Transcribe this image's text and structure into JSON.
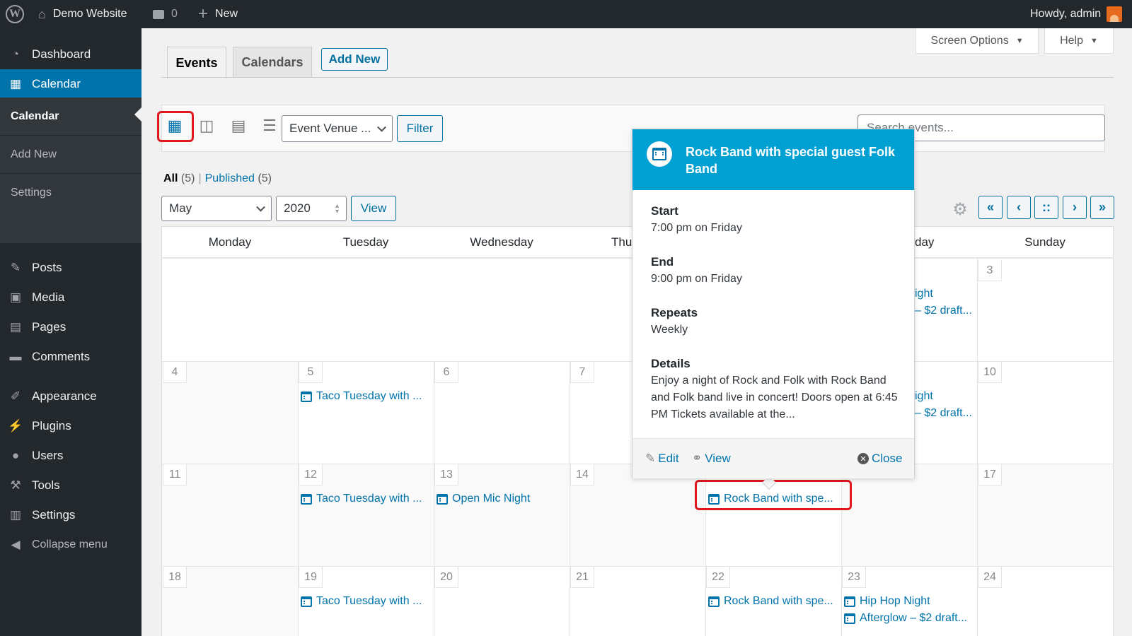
{
  "adminbar": {
    "site_name": "Demo Website",
    "comments_count": "0",
    "new_label": "New",
    "howdy": "Howdy, admin"
  },
  "sidebar": {
    "items": [
      {
        "label": "Dashboard",
        "icon": "dashboard-icon"
      },
      {
        "label": "Calendar",
        "icon": "calendar-icon"
      },
      {
        "label": "Posts",
        "icon": "pushpin-icon"
      },
      {
        "label": "Media",
        "icon": "media-icon"
      },
      {
        "label": "Pages",
        "icon": "pages-icon"
      },
      {
        "label": "Comments",
        "icon": "comment-icon"
      },
      {
        "label": "Appearance",
        "icon": "brush-icon"
      },
      {
        "label": "Plugins",
        "icon": "plug-icon"
      },
      {
        "label": "Users",
        "icon": "user-icon"
      },
      {
        "label": "Tools",
        "icon": "wrench-icon"
      },
      {
        "label": "Settings",
        "icon": "settings-icon"
      },
      {
        "label": "Collapse menu",
        "icon": "collapse-icon"
      }
    ],
    "submenu": [
      "Calendar",
      "Add New",
      "Settings"
    ]
  },
  "screen_options": "Screen Options",
  "help": "Help",
  "tabs": [
    "Events",
    "Calendars"
  ],
  "add_new": "Add New",
  "toolbar": {
    "venue_select": "Event Venue ...",
    "filter": "Filter",
    "search_placeholder": "Search events..."
  },
  "status": {
    "all": "All",
    "all_count": "(5)",
    "sep": "|",
    "published": "Published",
    "published_count": "(5)"
  },
  "date_controls": {
    "month": "May",
    "year": "2020",
    "view": "View"
  },
  "nav_buttons": [
    "«",
    "‹",
    "::",
    "›",
    "»"
  ],
  "calendar": {
    "days": [
      "Monday",
      "Tuesday",
      "Wednesday",
      "Thu",
      "day",
      "Sunday"
    ],
    "numbers": {
      "r1_sun": "3",
      "r2": [
        "4",
        "5",
        "6",
        "7",
        "10"
      ],
      "r3": [
        "11",
        "12",
        "13",
        "14",
        "17"
      ],
      "r4": [
        "18",
        "19",
        "20",
        "21",
        "22",
        "23",
        "24"
      ]
    },
    "events": {
      "taco": "Taco Tuesday with ...",
      "openmic": "Open Mic Night",
      "rockband": "Rock Band with spe...",
      "hiphop": "Hip Hop Night",
      "afterglow": "Afterglow – $2 draft...",
      "ight": "ight",
      "draft_partial": "– $2 draft..."
    }
  },
  "popover": {
    "title": "Rock Band with special guest Folk Band",
    "start_label": "Start",
    "start_value": "7:00 pm on Friday",
    "end_label": "End",
    "end_value": "9:00 pm on Friday",
    "repeats_label": "Repeats",
    "repeats_value": "Weekly",
    "details_label": "Details",
    "details_value": "Enjoy a night of Rock and Folk with Rock Band and Folk band live in concert! Doors open at 6:45 PM Tickets available at the...",
    "edit": "Edit",
    "view": "View",
    "close": "Close"
  },
  "colors": {
    "accent": "#0073aa",
    "popover_header": "#00a0d2",
    "adminbar": "#23282d",
    "highlight": "#e0191f"
  }
}
